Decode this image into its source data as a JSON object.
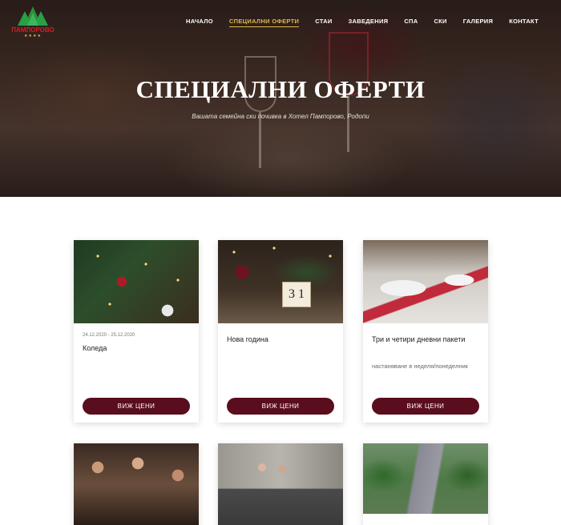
{
  "brand": {
    "logo_text": "ПАМПОРОВО",
    "logo_stars": "★★★★",
    "accent": "#e0b84a",
    "button_color": "#5a0d1c"
  },
  "nav": {
    "items": [
      {
        "label": "НАЧАЛО"
      },
      {
        "label": "СПЕЦИАЛНИ ОФЕРТИ"
      },
      {
        "label": "СТАИ"
      },
      {
        "label": "ЗАВЕДЕНИЯ"
      },
      {
        "label": "СПА"
      },
      {
        "label": "СКИ"
      },
      {
        "label": "ГАЛЕРИЯ"
      },
      {
        "label": "КОНТАКТ"
      }
    ],
    "active_index": 1
  },
  "hero": {
    "title": "СПЕЦИАЛНИ ОФЕРТИ",
    "subtitle": "Вашата семейна ски почивка в Хотел Пампорово, Родопи"
  },
  "offers": [
    {
      "date": "24.12.2020 - 25.12.2020",
      "title": "Коледа",
      "description": "",
      "button": "ВИЖ ЦЕНИ",
      "image": "christmas-ornaments"
    },
    {
      "date": "",
      "title": "Нова година",
      "description": "",
      "button": "ВИЖ ЦЕНИ",
      "image": "new-year-table"
    },
    {
      "date": "",
      "title": "Три и четири дневни пакети",
      "description": "настаняване в неделя/понеделник",
      "button": "ВИЖ ЦЕНИ",
      "image": "restaurant-table"
    },
    {
      "date": "",
      "title": "",
      "description": "",
      "button": "",
      "image": "party-friends"
    },
    {
      "date": "",
      "title": "",
      "description": "",
      "button": "",
      "image": "family-livingroom"
    },
    {
      "date": "",
      "title": "",
      "description": "",
      "button": "",
      "image": "town-aerial"
    }
  ]
}
